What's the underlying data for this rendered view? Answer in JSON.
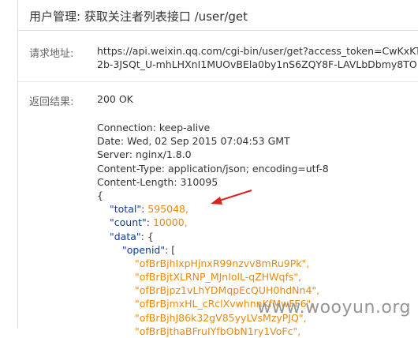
{
  "page": {
    "title": "用户管理: 获取关注者列表接口 /user/get",
    "request_label": "请求地址:",
    "request_url_line1": "https://api.weixin.qq.com/cgi-bin/user/get?access_token=CwKxKT",
    "request_url_line2": "2b-3JSQt_U-mhLHXnI1MUOvBEla0by1nS6ZQY8F-LAVLbDbmy8TO",
    "result_label": "返回结果:",
    "status": "200 OK"
  },
  "response": {
    "headers": [
      "Connection: keep-alive",
      "Date: Wed, 02 Sep 2015 07:04:53 GMT",
      "Server: nginx/1.8.0",
      "Content-Type: application/json; encoding=utf-8",
      "Content-Length: 310095"
    ],
    "open_brace": "{",
    "total_key": "\"total\"",
    "total_value": "595048,",
    "count_key": "\"count\"",
    "count_value": "10000,",
    "data_key": "\"data\"",
    "data_open": "{",
    "openid_key": "\"openid\"",
    "openid_open": "[",
    "colon": ": ",
    "openids": [
      "\"ofBrBjhIxpHjnxR99nzvv8mRu9Pk\",",
      "\"ofBrBjtXLRNP_MJnIolL-qZHWqfs\",",
      "\"ofBrBjpz1vLhYDMqpEcQUH0hdNn4\",",
      "\"ofBrBjmxHL_cRclXvwhnnKfMwFF6\",",
      "\"ofBrBjhJ86k32gV85yyLVsMzyPJQ\",",
      "\"ofBrBjthaBFruIYfbObN1ry1VoFc\","
    ]
  },
  "watermark": "www.wooyun.org",
  "colors": {
    "key": "#0a3d8f",
    "value": "#e8890c",
    "arrow": "#e02020"
  }
}
